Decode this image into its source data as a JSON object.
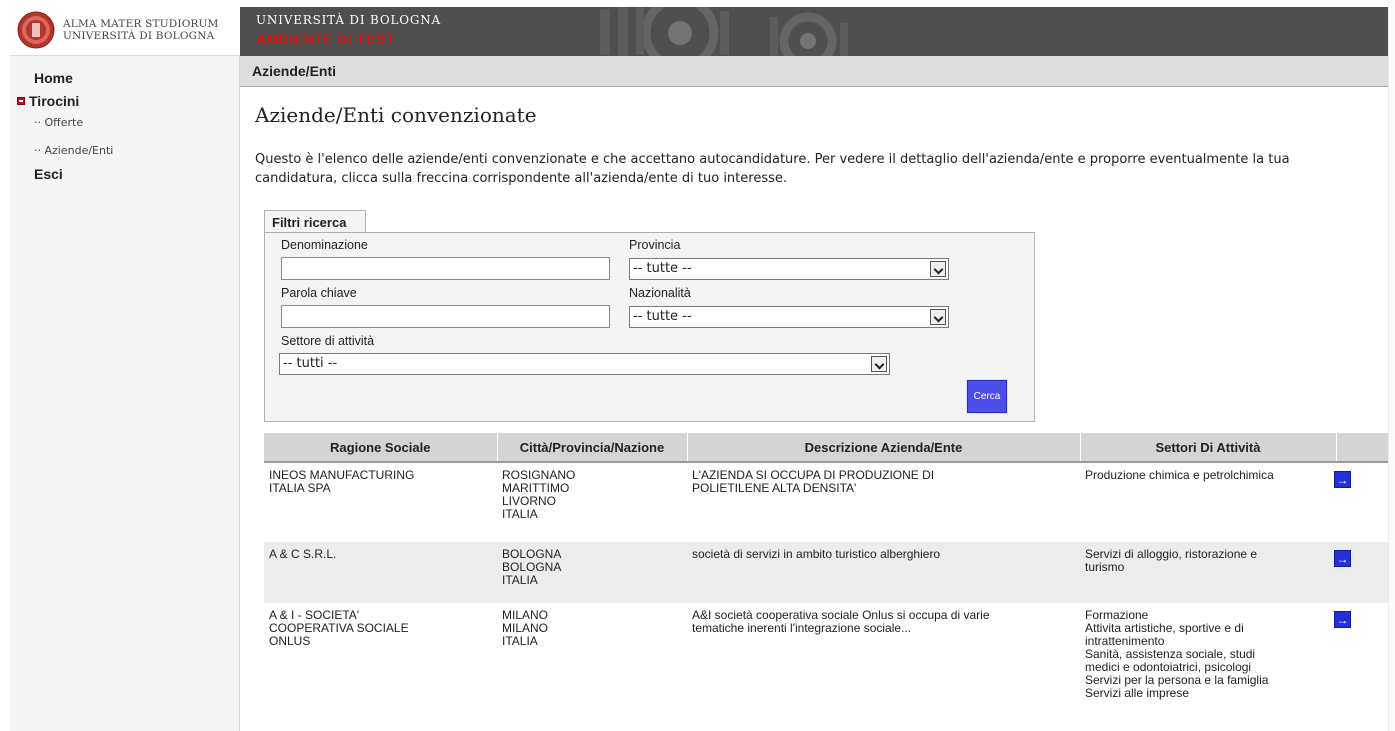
{
  "logo": {
    "line1": "ALMA MATER STUDIORUM",
    "line2": "UNIVERSITÀ DI BOLOGNA"
  },
  "banner": {
    "university": "UNIVERSITÀ DI BOLOGNA",
    "environment": "AMBIENTE DI TEST"
  },
  "nav": {
    "home": "Home",
    "tirocini": "Tirocini",
    "offerte": "·· Offerte",
    "aziende": "·· Aziende/Enti",
    "esci": "Esci"
  },
  "breadcrumb": "Aziende/Enti",
  "page": {
    "title": "Aziende/Enti convenzionate",
    "intro": "Questo è l'elenco delle aziende/enti convenzionate e che accettano autocandidature. Per vedere il dettaglio dell'azienda/ente e proporre eventualmente la tua candidatura, clicca sulla freccina corrispondente all'azienda/ente di tuo interesse."
  },
  "filters": {
    "tab_label": "Filtri ricerca",
    "denominazione_label": "Denominazione",
    "denominazione_value": "",
    "provincia_label": "Provincia",
    "provincia_value": "-- tutte --",
    "parola_label": "Parola chiave",
    "parola_value": "",
    "nazionalita_label": "Nazionalità",
    "nazionalita_value": "-- tutte --",
    "settore_label": "Settore di attività",
    "settore_value": "-- tutti --",
    "search_button": "Cerca"
  },
  "table": {
    "headers": {
      "name": "Ragione Sociale",
      "city": "Città/Provincia/Nazione",
      "desc": "Descrizione Azienda/Ente",
      "sectors": "Settori Di Attività"
    },
    "rows": [
      {
        "name": [
          "INEOS MANUFACTURING",
          "ITALIA SPA"
        ],
        "city": [
          "ROSIGNANO",
          "MARITTIMO",
          "LIVORNO",
          "ITALIA"
        ],
        "desc": [
          "L'AZIENDA SI OCCUPA DI PRODUZIONE DI",
          "POLIETILENE ALTA DENSITA'"
        ],
        "sectors": [
          "Produzione chimica e petrolchimica"
        ],
        "action": "→"
      },
      {
        "name": [
          "A & C S.R.L."
        ],
        "city": [
          "BOLOGNA",
          "BOLOGNA",
          "ITALIA"
        ],
        "desc": [
          "società di servizi in ambito turistico alberghiero"
        ],
        "sectors": [
          "Servizi di alloggio, ristorazione e",
          "turismo"
        ],
        "action": "→"
      },
      {
        "name": [
          "A & I - SOCIETA'",
          "COOPERATIVA SOCIALE",
          "ONLUS"
        ],
        "city": [
          "MILANO",
          "MILANO",
          "ITALIA"
        ],
        "desc": [
          "A&I società cooperativa sociale Onlus si occupa di varie",
          "tematiche inerenti l'integrazione sociale..."
        ],
        "sectors": [
          "Formazione",
          "Attivita artistiche, sportive e di",
          "intrattenimento",
          "Sanità, assistenza sociale, studi",
          "medici e odontoiatrici, psicologi",
          "Servizi per la persona e la famiglia",
          "Servizi alle imprese"
        ],
        "action": "→"
      }
    ]
  },
  "colors": {
    "banner_bg": "#4f4f4f",
    "test_red": "#e20f0f",
    "button_blue": "#4b4ee8",
    "arrow_blue": "#2431d9",
    "header_gray": "#d4d4d4"
  }
}
